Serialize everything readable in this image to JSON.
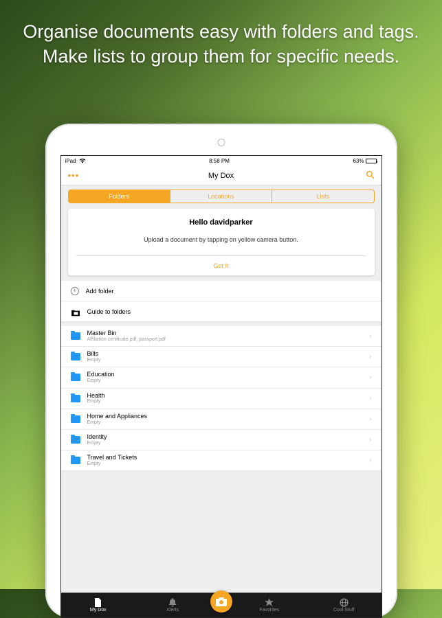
{
  "marketing": {
    "headline": "Organise documents easy with folders and tags. Make lists to group them for specific needs."
  },
  "status": {
    "device": "iPad",
    "time": "8:58 PM",
    "battery_pct": "63%"
  },
  "nav": {
    "title": "My Dox",
    "menu_glyph": "•••"
  },
  "tabs_top": {
    "items": [
      "Folders",
      "Locations",
      "Lists"
    ],
    "active": 0
  },
  "welcome": {
    "title": "Hello davidparker",
    "body": "Upload a document by tapping on yellow camera button.",
    "action": "Got It"
  },
  "actions": {
    "add_folder": "Add folder",
    "guide": "Guide to folders"
  },
  "folders": [
    {
      "name": "Master Bin",
      "subtitle": "Affiliation certificate.pdf, passport.pdf"
    },
    {
      "name": "Bills",
      "subtitle": "Empty"
    },
    {
      "name": "Education",
      "subtitle": "Empty"
    },
    {
      "name": "Health",
      "subtitle": "Empty"
    },
    {
      "name": "Home and Appliances",
      "subtitle": "Empty"
    },
    {
      "name": "Identity",
      "subtitle": "Empty"
    },
    {
      "name": "Travel and Tickets",
      "subtitle": "Empty"
    }
  ],
  "bottom_tabs": {
    "items": [
      "My Dox",
      "Alerts",
      "",
      "Favorites",
      "Cool Stuff"
    ],
    "active": 0
  }
}
